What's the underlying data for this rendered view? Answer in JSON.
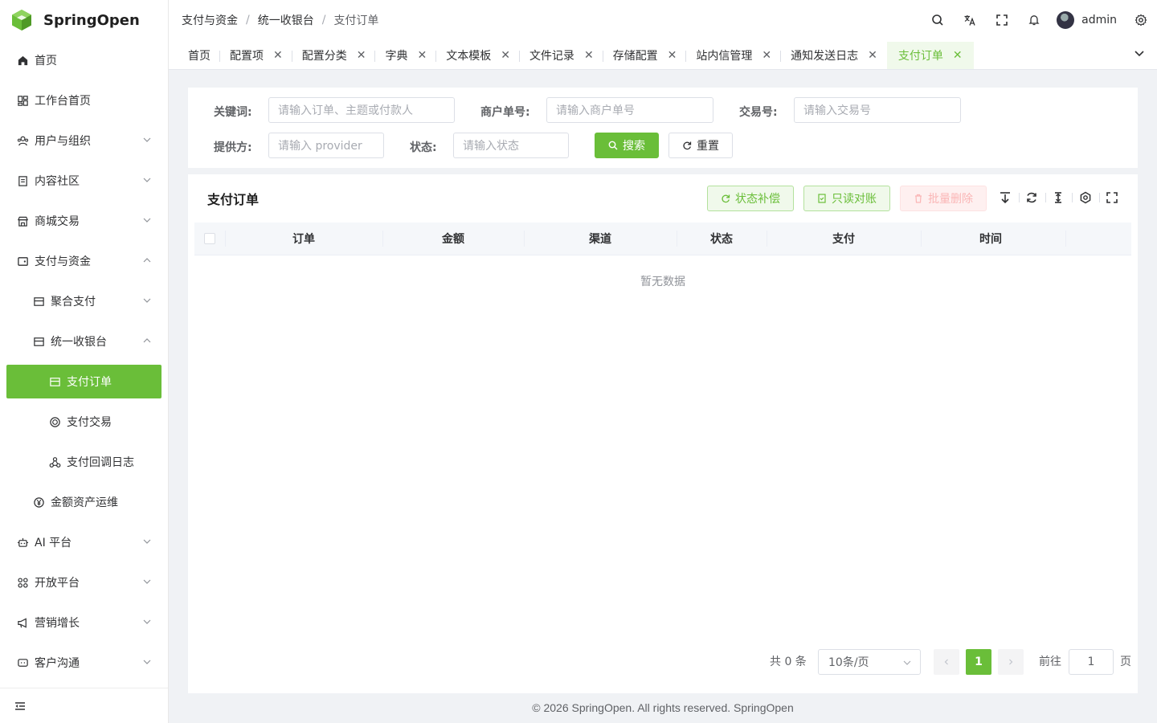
{
  "app": {
    "name": "SpringOpen",
    "brand_color": "#6abe39"
  },
  "sidebar": {
    "items": [
      {
        "label": "首页",
        "icon": "home-icon"
      },
      {
        "label": "工作台首页",
        "icon": "dashboard-icon"
      },
      {
        "label": "用户与组织",
        "icon": "users-icon",
        "expandable": true
      },
      {
        "label": "内容社区",
        "icon": "document-icon",
        "expandable": true
      },
      {
        "label": "商城交易",
        "icon": "shop-icon",
        "expandable": true
      },
      {
        "label": "支付与资金",
        "icon": "wallet-icon",
        "expanded": true
      },
      {
        "label": "聚合支付",
        "icon": "card-icon",
        "expandable": true
      },
      {
        "label": "统一收银台",
        "icon": "card-icon",
        "expanded": true
      },
      {
        "label": "支付订单",
        "icon": "card-icon",
        "active": true
      },
      {
        "label": "支付交易",
        "icon": "coin-icon"
      },
      {
        "label": "支付回调日志",
        "icon": "webhook-icon"
      },
      {
        "label": "金额资产运维",
        "icon": "yen-icon"
      },
      {
        "label": "AI 平台",
        "icon": "robot-icon",
        "expandable": true
      },
      {
        "label": "开放平台",
        "icon": "grid-icon",
        "expandable": true
      },
      {
        "label": "营销增长",
        "icon": "megaphone-icon",
        "expandable": true
      },
      {
        "label": "客户沟通",
        "icon": "chat-icon",
        "expandable": true
      }
    ]
  },
  "header": {
    "breadcrumb": [
      "支付与资金",
      "统一收银台",
      "支付订单"
    ],
    "separator": "/",
    "username": "admin"
  },
  "tabs": [
    {
      "label": "首页",
      "closable": false
    },
    {
      "label": "配置项",
      "closable": true
    },
    {
      "label": "配置分类",
      "closable": true
    },
    {
      "label": "字典",
      "closable": true
    },
    {
      "label": "文本模板",
      "closable": true
    },
    {
      "label": "文件记录",
      "closable": true
    },
    {
      "label": "存储配置",
      "closable": true
    },
    {
      "label": "站内信管理",
      "closable": true
    },
    {
      "label": "通知发送日志",
      "closable": true
    },
    {
      "label": "支付订单",
      "closable": true,
      "active": true
    }
  ],
  "search": {
    "keyword_label": "关键词:",
    "keyword_placeholder": "请输入订单、主题或付款人",
    "merchant_label": "商户单号:",
    "merchant_placeholder": "请输入商户单号",
    "trade_label": "交易号:",
    "trade_placeholder": "请输入交易号",
    "provider_label": "提供方:",
    "provider_placeholder": "请输入 provider",
    "status_label": "状态:",
    "status_placeholder": "请输入状态",
    "search_button": "搜索",
    "reset_button": "重置"
  },
  "table": {
    "title": "支付订单",
    "actions": {
      "status_comp": "状态补偿",
      "readonly_reconcile": "只读对账",
      "batch_delete": "批量删除"
    },
    "columns": [
      "订单",
      "金额",
      "渠道",
      "状态",
      "支付",
      "时间"
    ],
    "empty_text": "暂无数据"
  },
  "pagination": {
    "total_text": "共 0 条",
    "page_size": "10条/页",
    "current_page": "1",
    "goto_label": "前往",
    "goto_value": "1",
    "page_suffix": "页"
  },
  "footer": {
    "text": "© 2026 SpringOpen. All rights reserved. SpringOpen"
  }
}
